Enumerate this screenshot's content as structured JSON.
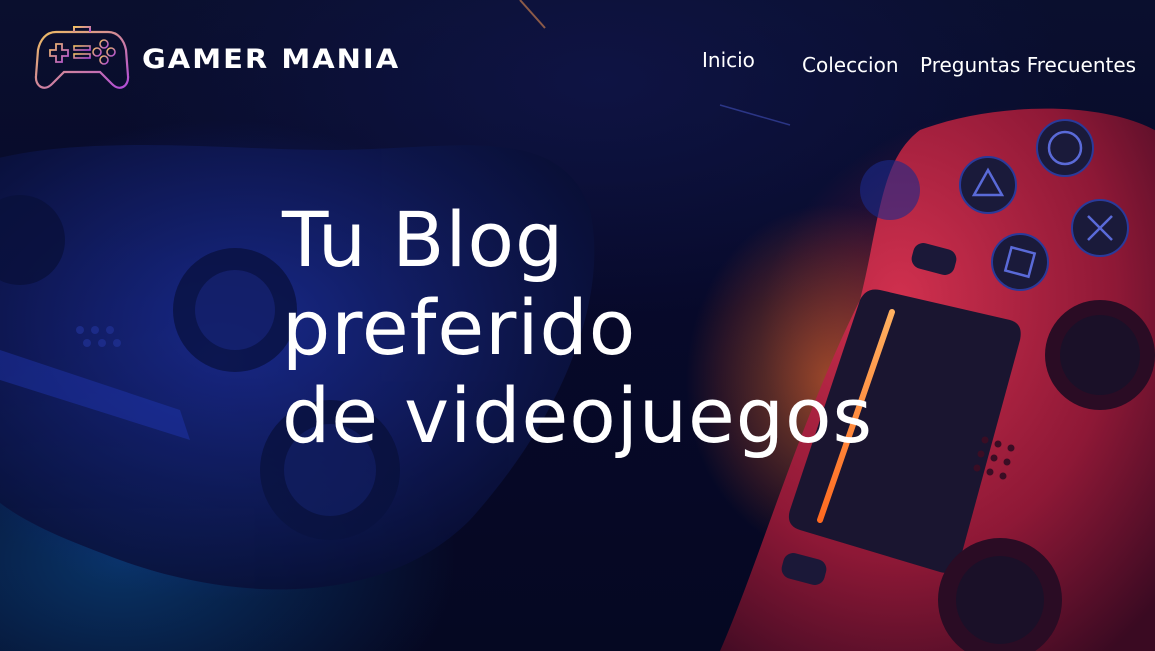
{
  "brand": {
    "name": "GAMER MANIA",
    "logo_icon": "gamepad-icon"
  },
  "nav": {
    "items": [
      {
        "label": "Inicio"
      },
      {
        "label": "Coleccion"
      },
      {
        "label": "Preguntas Frecuentes"
      }
    ]
  },
  "hero": {
    "headline_lines": [
      "Tu Blog",
      "preferido",
      "de videojuegos"
    ]
  },
  "colors": {
    "logo_gradient_start": "#f0c060",
    "logo_gradient_end": "#b04ad8",
    "text": "#ffffff",
    "controller_red": "#b4203e",
    "light_bar_orange": "#ff9a3a"
  }
}
